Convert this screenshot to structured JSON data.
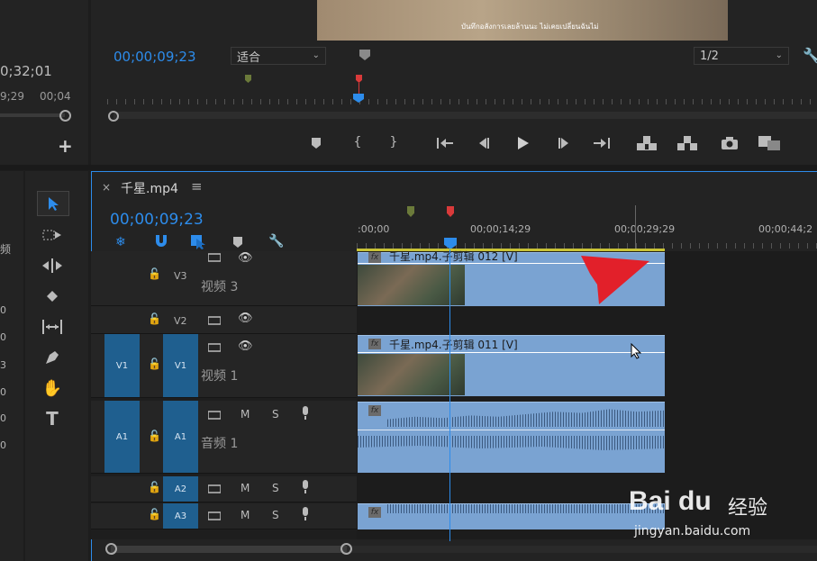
{
  "colors": {
    "accent": "#2d8ceb",
    "clip": "#7aa3d2",
    "playhead": "#2d8ceb",
    "marker_red": "#d93a3a",
    "marker_green": "#6b7a3a"
  },
  "program": {
    "timecode": "00;00;09;23",
    "fit_select": "适合",
    "resolution_select": "1/2",
    "video_subtitle": "บันทึกอลังการเลยล้านนะ ไม่เคยเปลี่ยนฉันไม่",
    "controls": [
      "marker-add-icon",
      "mark-in-icon",
      "mark-out-icon",
      "go-to-in-icon",
      "step-back-icon",
      "play-icon",
      "step-forward-icon",
      "go-to-out-icon",
      "lift-icon",
      "extract-icon",
      "export-frame-icon",
      "comparison-icon"
    ]
  },
  "source": {
    "timecode": "0;32;01",
    "ruler_label_1": "9;29",
    "ruler_label_2": "00;04"
  },
  "project_side": {
    "label": "频",
    "nums": [
      "0",
      "0",
      "3",
      "0",
      "0",
      "0"
    ]
  },
  "timeline": {
    "tab_title": "千星.mp4",
    "close_symbol": "×",
    "menu_symbol": "≡",
    "timecode": "00;00;09;23",
    "ruler_labels": [
      ":00;00",
      "00;00;14;29",
      "00;00;29;29",
      "00;00;44;2"
    ],
    "tracks": {
      "v3": {
        "name": "V3",
        "label": "视频 3"
      },
      "v2": {
        "name": "V2",
        "label": ""
      },
      "v1": {
        "name": "V1",
        "src": "V1",
        "label": "视频 1"
      },
      "a1": {
        "name": "A1",
        "src": "A1",
        "label": "音频 1",
        "m": "M",
        "s": "S"
      },
      "a2": {
        "name": "A2",
        "m": "M",
        "s": "S"
      },
      "a3": {
        "name": "A3",
        "m": "M",
        "s": "S"
      }
    },
    "clips": {
      "v3_clip": "千星.mp4.子剪辑 012 [V]",
      "v1_clip": "千星.mp4.子剪辑 011 [V]"
    },
    "fx_label": "fx"
  },
  "watermark": {
    "brand_text": "Bai du",
    "brand_cn": "经验",
    "url": "jingyan.baidu.com"
  }
}
